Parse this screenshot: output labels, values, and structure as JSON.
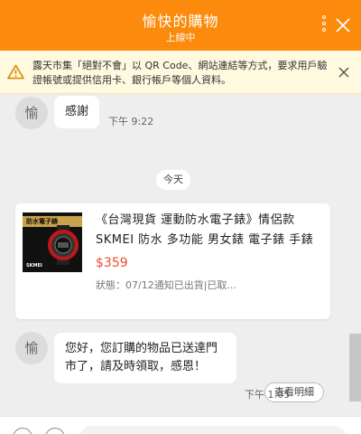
{
  "header": {
    "title": "愉快的購物",
    "subtitle": "上線中",
    "more_icon": "more-vertical-icon",
    "close_icon": "close-icon",
    "accent_color": "#fc8a0c"
  },
  "warning": {
    "icon": "warning-triangle-icon",
    "text": "露天市集「絕對不會」以 QR Code、網站連結等方式，要求用戶驗證帳號或提供信用卡、銀行帳戶等個人資料。",
    "close_icon": "close-icon"
  },
  "messages": [
    {
      "avatar": "愉",
      "text": "感謝",
      "time": "下午 9:22"
    },
    {
      "avatar": "愉",
      "text": "您好，您訂購的物品已送達門市了，請及時領取，感恩！",
      "time": "下午 1:05"
    }
  ],
  "date_separator": "今天",
  "order": {
    "image_banner": "防水電子錶",
    "image_brand": "SKMEI",
    "product_name": "《台灣現貨 運動防水電子錶》情侶款 SKMEI 防水 多功能 男女錶 電子錶 手錶",
    "price": "$359",
    "status": "狀態：07/12通知已出貨|已取...",
    "details_button": "查看明細",
    "price_color": "#ee4d2d"
  }
}
